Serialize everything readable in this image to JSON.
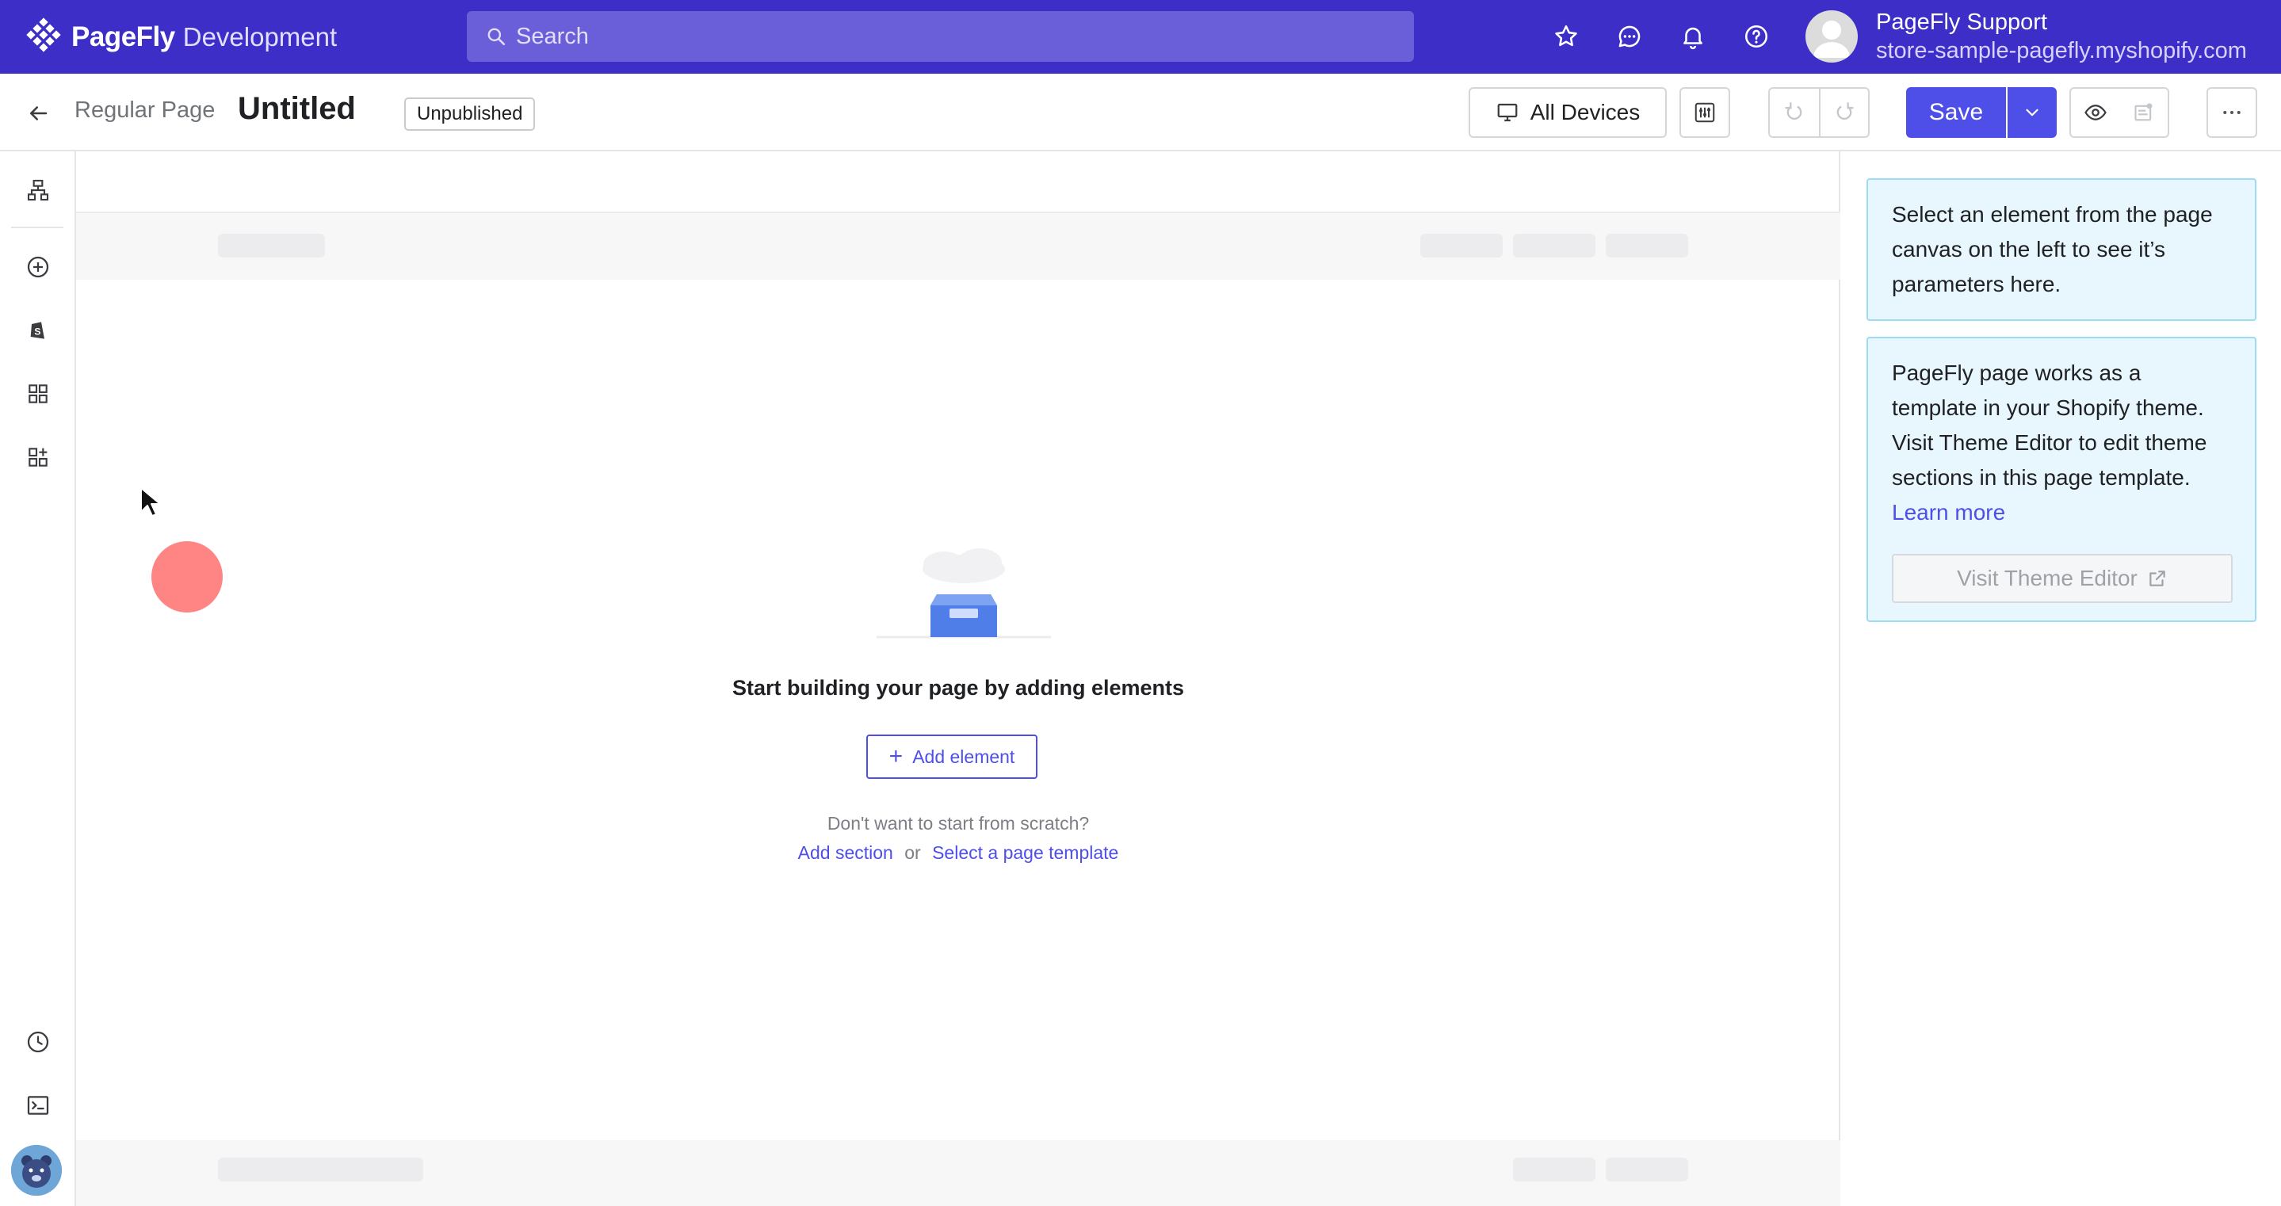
{
  "topbar": {
    "brand_name": "PageFly",
    "environment": "Development",
    "search_placeholder": "Search",
    "icons": [
      "star-icon",
      "chat-icon",
      "bell-icon",
      "help-icon"
    ],
    "user_name": "PageFly Support",
    "user_store": "store-sample-pagefly.myshopify.com",
    "accent_color": "#3c2ec7"
  },
  "toolbar": {
    "page_type": "Regular Page",
    "page_title": "Untitled",
    "status": "Unpublished",
    "devices_label": "All Devices",
    "save_label": "Save",
    "more_label": "···"
  },
  "sidebar": {
    "items": [
      "sitemap-icon",
      "add-circle-icon",
      "shopify-icon",
      "grid-icon",
      "add-widget-icon",
      "clock-icon",
      "terminal-icon"
    ]
  },
  "canvas": {
    "empty_title": "Start building your page by adding elements",
    "add_element_label": "Add element",
    "scratch_question": "Don't want to start from scratch?",
    "add_section_link": "Add section",
    "or_text": "or",
    "template_link": "Select a page template"
  },
  "right_panel": {
    "select_hint": "Select an element from the page canvas on the left to see it’s parameters here.",
    "template_info": "PageFly page works as a template in your Shopify theme. Visit Theme Editor to edit theme sections in this page template.",
    "learn_more": "Learn more",
    "theme_editor_button": "Visit Theme Editor"
  }
}
